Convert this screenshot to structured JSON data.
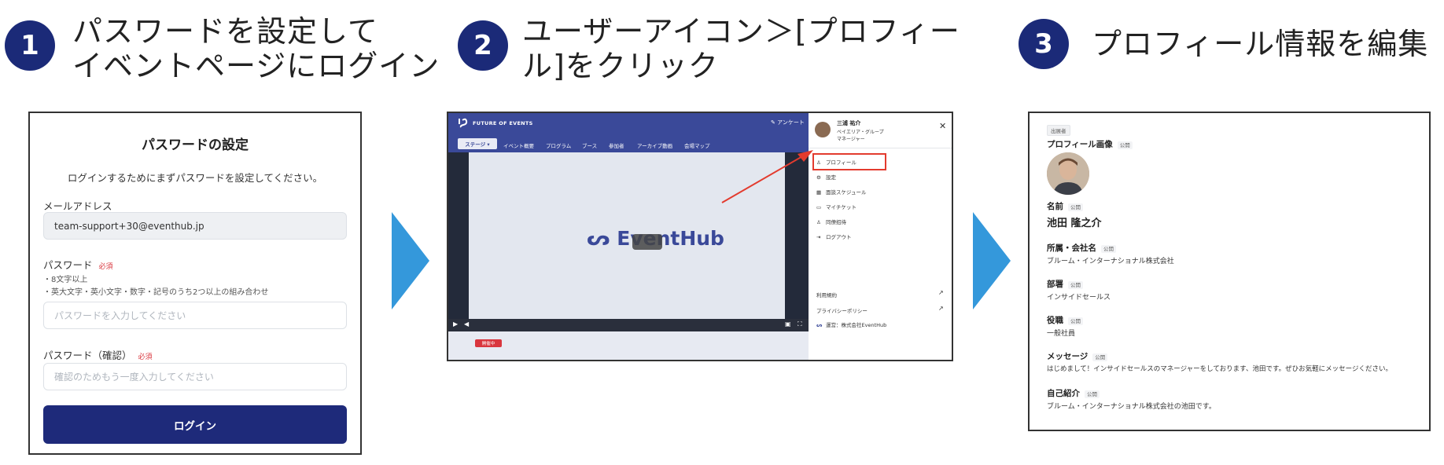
{
  "steps": [
    {
      "num": "1",
      "line1": "パスワードを設定して",
      "line2": "イベントページにログイン"
    },
    {
      "num": "2",
      "line1": "ユーザーアイコン＞[プロフィー",
      "line2": "ル]をクリック"
    },
    {
      "num": "3",
      "line1": "プロフィール情報を編集",
      "line2": ""
    }
  ],
  "colors": {
    "step_badge": "#1b2a78",
    "arrow": "#3498db",
    "primary_button": "#1e2a7a",
    "highlight": "#e33b2e",
    "header": "#3a4999"
  },
  "login": {
    "title": "パスワードの設定",
    "subtitle": "ログインするためにまずパスワードを設定してください。",
    "email_label": "メールアドレス",
    "email_value": "team-support+30@eventhub.jp",
    "password_label": "パスワード",
    "required": "必須",
    "rule1": "・8文字以上",
    "rule2": "・英大文字・英小文字・数字・記号のうち2つ以上の組み合わせ",
    "password_placeholder": "パスワードを入力してください",
    "confirm_label": "パスワード（確認）",
    "confirm_placeholder": "確認のためもう一度入力してください",
    "login_button": "ログイン"
  },
  "event": {
    "brand": "FUTURE OF EVENTS",
    "survey": "アンケート",
    "nav": [
      "ステージ ▾",
      "イベント概要",
      "プログラム",
      "ブース",
      "参加者",
      "アーカイブ動画",
      "会場マップ"
    ],
    "video_logo": "EventHub",
    "live_badge": "開催中",
    "user": {
      "name": "三浦 祐介",
      "org": "ベイエリア・グループ",
      "role": "マネージャー"
    },
    "menu": [
      "プロフィール",
      "設定",
      "面談スケジュール",
      "マイチケット",
      "同僚招待",
      "ログアウト"
    ],
    "footer_links": [
      "利用規約",
      "プライバシーポリシー"
    ],
    "operator": "運営：株式会社EventHub"
  },
  "profile": {
    "tag": "出展者",
    "public": "公開",
    "image_label": "プロフィール画像",
    "name_label": "名前",
    "name_value": "池田 隆之介",
    "company_label": "所属・会社名",
    "company_value": "ブルーム・インターナショナル株式会社",
    "dept_label": "部署",
    "dept_value": "インサイドセールス",
    "title_label": "役職",
    "title_value": "一般社員",
    "message_label": "メッセージ",
    "message_value": "はじめまして！インサイドセールスのマネージャーをしております、池田です。ぜひお気軽にメッセージください。",
    "intro_label": "自己紹介",
    "intro_value": "ブルーム・インターナショナル株式会社の池田です。"
  }
}
